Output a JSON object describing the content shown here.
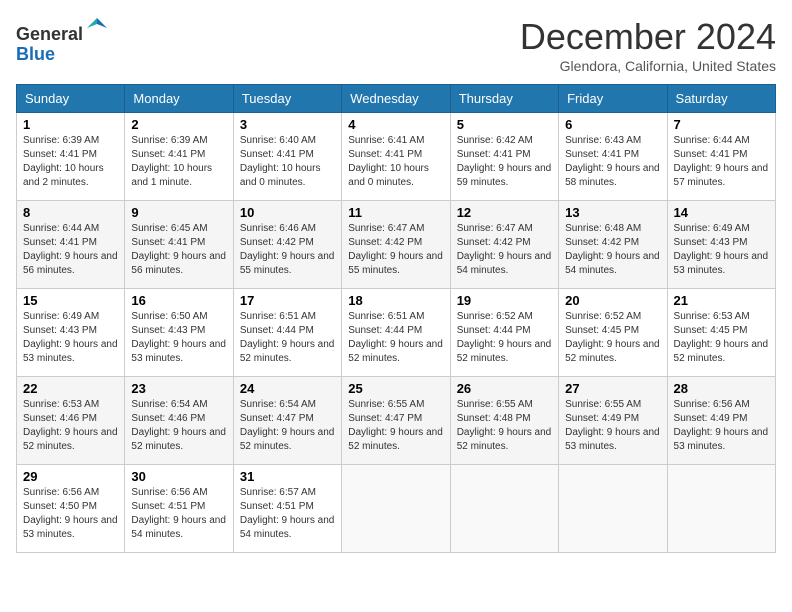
{
  "header": {
    "logo_line1": "General",
    "logo_line2": "Blue",
    "month_title": "December 2024",
    "location": "Glendora, California, United States"
  },
  "days_of_week": [
    "Sunday",
    "Monday",
    "Tuesday",
    "Wednesday",
    "Thursday",
    "Friday",
    "Saturday"
  ],
  "weeks": [
    [
      {
        "day": "1",
        "sunrise": "6:39 AM",
        "sunset": "4:41 PM",
        "daylight": "10 hours and 2 minutes."
      },
      {
        "day": "2",
        "sunrise": "6:39 AM",
        "sunset": "4:41 PM",
        "daylight": "10 hours and 1 minute."
      },
      {
        "day": "3",
        "sunrise": "6:40 AM",
        "sunset": "4:41 PM",
        "daylight": "10 hours and 0 minutes."
      },
      {
        "day": "4",
        "sunrise": "6:41 AM",
        "sunset": "4:41 PM",
        "daylight": "10 hours and 0 minutes."
      },
      {
        "day": "5",
        "sunrise": "6:42 AM",
        "sunset": "4:41 PM",
        "daylight": "9 hours and 59 minutes."
      },
      {
        "day": "6",
        "sunrise": "6:43 AM",
        "sunset": "4:41 PM",
        "daylight": "9 hours and 58 minutes."
      },
      {
        "day": "7",
        "sunrise": "6:44 AM",
        "sunset": "4:41 PM",
        "daylight": "9 hours and 57 minutes."
      }
    ],
    [
      {
        "day": "8",
        "sunrise": "6:44 AM",
        "sunset": "4:41 PM",
        "daylight": "9 hours and 56 minutes."
      },
      {
        "day": "9",
        "sunrise": "6:45 AM",
        "sunset": "4:41 PM",
        "daylight": "9 hours and 56 minutes."
      },
      {
        "day": "10",
        "sunrise": "6:46 AM",
        "sunset": "4:42 PM",
        "daylight": "9 hours and 55 minutes."
      },
      {
        "day": "11",
        "sunrise": "6:47 AM",
        "sunset": "4:42 PM",
        "daylight": "9 hours and 55 minutes."
      },
      {
        "day": "12",
        "sunrise": "6:47 AM",
        "sunset": "4:42 PM",
        "daylight": "9 hours and 54 minutes."
      },
      {
        "day": "13",
        "sunrise": "6:48 AM",
        "sunset": "4:42 PM",
        "daylight": "9 hours and 54 minutes."
      },
      {
        "day": "14",
        "sunrise": "6:49 AM",
        "sunset": "4:43 PM",
        "daylight": "9 hours and 53 minutes."
      }
    ],
    [
      {
        "day": "15",
        "sunrise": "6:49 AM",
        "sunset": "4:43 PM",
        "daylight": "9 hours and 53 minutes."
      },
      {
        "day": "16",
        "sunrise": "6:50 AM",
        "sunset": "4:43 PM",
        "daylight": "9 hours and 53 minutes."
      },
      {
        "day": "17",
        "sunrise": "6:51 AM",
        "sunset": "4:44 PM",
        "daylight": "9 hours and 52 minutes."
      },
      {
        "day": "18",
        "sunrise": "6:51 AM",
        "sunset": "4:44 PM",
        "daylight": "9 hours and 52 minutes."
      },
      {
        "day": "19",
        "sunrise": "6:52 AM",
        "sunset": "4:44 PM",
        "daylight": "9 hours and 52 minutes."
      },
      {
        "day": "20",
        "sunrise": "6:52 AM",
        "sunset": "4:45 PM",
        "daylight": "9 hours and 52 minutes."
      },
      {
        "day": "21",
        "sunrise": "6:53 AM",
        "sunset": "4:45 PM",
        "daylight": "9 hours and 52 minutes."
      }
    ],
    [
      {
        "day": "22",
        "sunrise": "6:53 AM",
        "sunset": "4:46 PM",
        "daylight": "9 hours and 52 minutes."
      },
      {
        "day": "23",
        "sunrise": "6:54 AM",
        "sunset": "4:46 PM",
        "daylight": "9 hours and 52 minutes."
      },
      {
        "day": "24",
        "sunrise": "6:54 AM",
        "sunset": "4:47 PM",
        "daylight": "9 hours and 52 minutes."
      },
      {
        "day": "25",
        "sunrise": "6:55 AM",
        "sunset": "4:47 PM",
        "daylight": "9 hours and 52 minutes."
      },
      {
        "day": "26",
        "sunrise": "6:55 AM",
        "sunset": "4:48 PM",
        "daylight": "9 hours and 52 minutes."
      },
      {
        "day": "27",
        "sunrise": "6:55 AM",
        "sunset": "4:49 PM",
        "daylight": "9 hours and 53 minutes."
      },
      {
        "day": "28",
        "sunrise": "6:56 AM",
        "sunset": "4:49 PM",
        "daylight": "9 hours and 53 minutes."
      }
    ],
    [
      {
        "day": "29",
        "sunrise": "6:56 AM",
        "sunset": "4:50 PM",
        "daylight": "9 hours and 53 minutes."
      },
      {
        "day": "30",
        "sunrise": "6:56 AM",
        "sunset": "4:51 PM",
        "daylight": "9 hours and 54 minutes."
      },
      {
        "day": "31",
        "sunrise": "6:57 AM",
        "sunset": "4:51 PM",
        "daylight": "9 hours and 54 minutes."
      },
      null,
      null,
      null,
      null
    ]
  ],
  "labels": {
    "sunrise": "Sunrise:",
    "sunset": "Sunset:",
    "daylight": "Daylight:"
  }
}
